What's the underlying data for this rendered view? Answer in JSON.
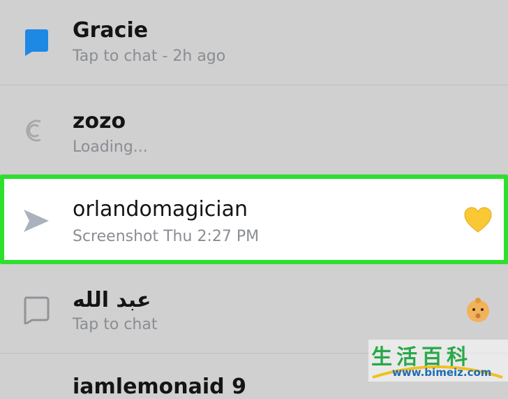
{
  "chats": [
    {
      "name": "Gracie",
      "status": "Tap to chat - 2h ago",
      "icon": "chat-bubble-filled-icon",
      "icon_color": "#2196f3"
    },
    {
      "name": "zozo",
      "status": "Loading...",
      "icon": "loading-spinner-icon"
    },
    {
      "name": "orlandomagician",
      "status": "Screenshot Thu 2:27 PM",
      "icon": "sent-arrow-icon",
      "emoji": "yellow-heart-icon",
      "highlighted": true,
      "highlight_color": "#2de02d"
    },
    {
      "name": "عبد الله",
      "status": "Tap to chat",
      "icon": "chat-bubble-outline-icon",
      "emoji": "baby-face-icon"
    },
    {
      "name": "iamlemonaid 9"
    }
  ],
  "watermark": {
    "title": "生活百科",
    "url": "www.bimeiz.com"
  }
}
